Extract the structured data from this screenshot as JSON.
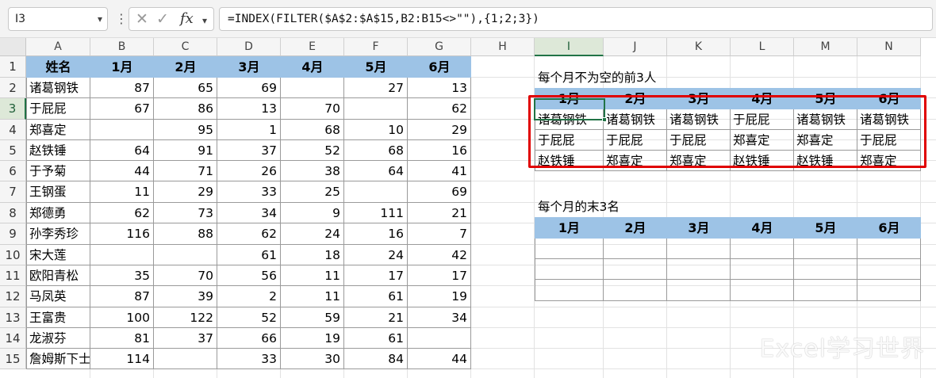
{
  "formula_bar": {
    "name_box": "I3",
    "formula": "=INDEX(FILTER($A$2:$A$15,B2:B15<>\"\"),{1;2;3})"
  },
  "icons": {
    "cancel": "✕",
    "confirm": "✓",
    "fx": "fx",
    "dropdown": "▾",
    "more": "⋮"
  },
  "columns": [
    "A",
    "B",
    "C",
    "D",
    "E",
    "F",
    "G",
    "H",
    "I",
    "J",
    "K",
    "L",
    "M",
    "N"
  ],
  "rows": [
    "1",
    "2",
    "3",
    "4",
    "5",
    "6",
    "7",
    "8",
    "9",
    "10",
    "11",
    "12",
    "13",
    "14",
    "15"
  ],
  "source_table": {
    "headers": [
      "姓名",
      "1月",
      "2月",
      "3月",
      "4月",
      "5月",
      "6月"
    ],
    "rows": [
      [
        "诸葛钢铁",
        "87",
        "65",
        "69",
        "",
        "27",
        "13"
      ],
      [
        "于屁屁",
        "67",
        "86",
        "13",
        "70",
        "",
        "62"
      ],
      [
        "郑喜定",
        "",
        "95",
        "1",
        "68",
        "10",
        "29"
      ],
      [
        "赵铁锤",
        "64",
        "91",
        "37",
        "52",
        "68",
        "16"
      ],
      [
        "于予菊",
        "44",
        "71",
        "26",
        "38",
        "64",
        "41"
      ],
      [
        "王钢蛋",
        "11",
        "29",
        "33",
        "25",
        "",
        "69"
      ],
      [
        "郑德勇",
        "62",
        "73",
        "34",
        "9",
        "111",
        "21"
      ],
      [
        "孙李秀珍",
        "116",
        "88",
        "62",
        "24",
        "16",
        "7"
      ],
      [
        "宋大莲",
        "",
        "",
        "61",
        "18",
        "24",
        "42"
      ],
      [
        "欧阳青松",
        "35",
        "70",
        "56",
        "11",
        "17",
        "17"
      ],
      [
        "马凤英",
        "87",
        "39",
        "2",
        "11",
        "61",
        "19"
      ],
      [
        "王富贵",
        "100",
        "122",
        "52",
        "59",
        "21",
        "34"
      ],
      [
        "龙淑芬",
        "81",
        "37",
        "66",
        "19",
        "61",
        ""
      ],
      [
        "詹姆斯下士",
        "114",
        "",
        "33",
        "30",
        "84",
        "44"
      ]
    ]
  },
  "top3": {
    "title": "每个月不为空的前3人",
    "headers": [
      "1月",
      "2月",
      "3月",
      "4月",
      "5月",
      "6月"
    ],
    "rows": [
      [
        "诸葛钢铁",
        "诸葛钢铁",
        "诸葛钢铁",
        "于屁屁",
        "诸葛钢铁",
        "诸葛钢铁"
      ],
      [
        "于屁屁",
        "于屁屁",
        "于屁屁",
        "郑喜定",
        "郑喜定",
        "于屁屁"
      ],
      [
        "赵铁锤",
        "郑喜定",
        "郑喜定",
        "赵铁锤",
        "赵铁锤",
        "郑喜定"
      ]
    ]
  },
  "last3": {
    "title": "每个月的末3名",
    "headers": [
      "1月",
      "2月",
      "3月",
      "4月",
      "5月",
      "6月"
    ],
    "rows": [
      [
        "",
        "",
        "",
        "",
        "",
        ""
      ],
      [
        "",
        "",
        "",
        "",
        "",
        ""
      ],
      [
        "",
        "",
        "",
        "",
        "",
        ""
      ]
    ]
  },
  "watermark": "Excel学习世界",
  "colors": {
    "header_fill": "#9dc3e6",
    "highlight_border": "#e00000",
    "excel_green": "#217346"
  }
}
